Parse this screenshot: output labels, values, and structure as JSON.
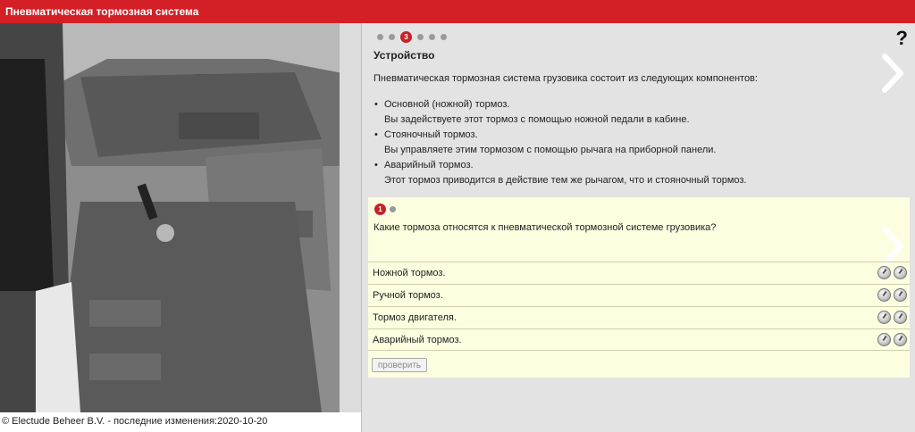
{
  "header": {
    "title": "Пневматическая тормозная система"
  },
  "footer": {
    "copyright": "© Electude Beheer B.V. - последние изменения:2020-10-20"
  },
  "pager": {
    "active_page": "3",
    "total_dots": 6,
    "active_index": 2
  },
  "help": {
    "label": "?"
  },
  "content": {
    "section_title": "Устройство",
    "intro": "Пневматическая тормозная система грузовика состоит из следующих компонентов:",
    "bullets": [
      {
        "title": "Основной (ножной) тормоз.",
        "desc": "Вы задействуете этот тормоз с помощью ножной педали в кабине."
      },
      {
        "title": "Стояночный тормоз.",
        "desc": "Вы управляете этим тормозом с помощью рычага на приборной панели."
      },
      {
        "title": "Аварийный тормоз.",
        "desc": "Этот тормоз приводится в действие тем же рычагом, что и стояночный тормоз."
      }
    ]
  },
  "quiz": {
    "question_number": "1",
    "question": "Какие тормоза относятся к пневматической тормозной системе грузовика?",
    "answers": [
      "Ножной тормоз.",
      "Ручной тормоз.",
      "Тормоз двигателя.",
      "Аварийный тормоз."
    ],
    "check_label": "проверить"
  },
  "colors": {
    "accent": "#d41f26",
    "panel": "#e3e3e3",
    "quiz_bg": "#fdfde0"
  }
}
